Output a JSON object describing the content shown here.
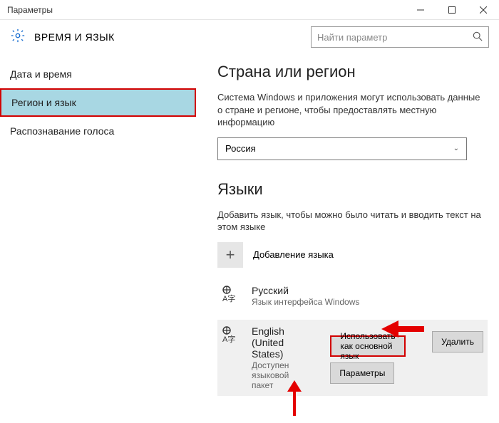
{
  "window": {
    "title": "Параметры"
  },
  "header": {
    "section_title": "ВРЕМЯ И ЯЗЫК",
    "search_placeholder": "Найти параметр"
  },
  "sidebar": {
    "items": [
      {
        "label": "Дата и время"
      },
      {
        "label": "Регион и язык"
      },
      {
        "label": "Распознавание голоса"
      }
    ]
  },
  "region": {
    "heading": "Страна или регион",
    "description": "Система Windows и приложения могут использовать данные о стране и регионе, чтобы предоставлять местную информацию",
    "selected": "Россия"
  },
  "languages": {
    "heading": "Языки",
    "description": "Добавить язык, чтобы можно было читать и вводить текст на этом языке",
    "add_label": "Добавление языка",
    "items": [
      {
        "name": "Русский",
        "sub": "Язык интерфейса Windows"
      },
      {
        "name": "English (United States)",
        "sub": "Доступен языковой пакет"
      }
    ],
    "buttons": {
      "set_default": "Использовать как основной язык",
      "options": "Параметры",
      "remove": "Удалить"
    }
  }
}
